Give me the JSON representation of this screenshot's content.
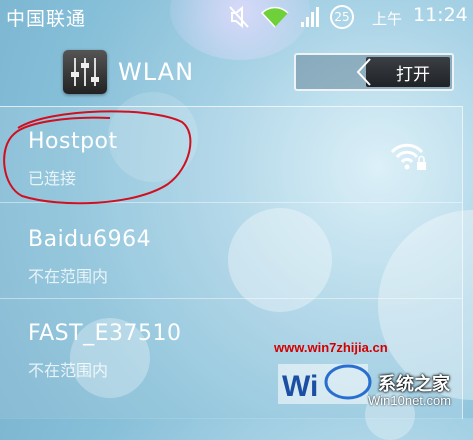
{
  "status_bar": {
    "carrier": "中国联通",
    "battery": "25",
    "ampm": "上午",
    "time": "11:24",
    "icons": [
      "mute-icon",
      "wifi-icon",
      "signal-icon",
      "battery-icon"
    ]
  },
  "header": {
    "title": "WLAN",
    "toggle_label": "打开",
    "app_icon": "settings-sliders-icon"
  },
  "networks": [
    {
      "ssid": "Hostpot",
      "state": "已连接",
      "icon": "wifi-lock-icon"
    },
    {
      "ssid": "Baidu6964",
      "state": "不在范围内"
    },
    {
      "ssid": "FAST_E37510",
      "state": "不在范围内"
    }
  ],
  "watermark": {
    "url": "www.win7zhijia.cn",
    "brand": "系统之家",
    "site": "Win10net.com"
  },
  "colors": {
    "annotation": "#d01020",
    "watermark": "#d40000",
    "background": "#9ccbe0"
  }
}
